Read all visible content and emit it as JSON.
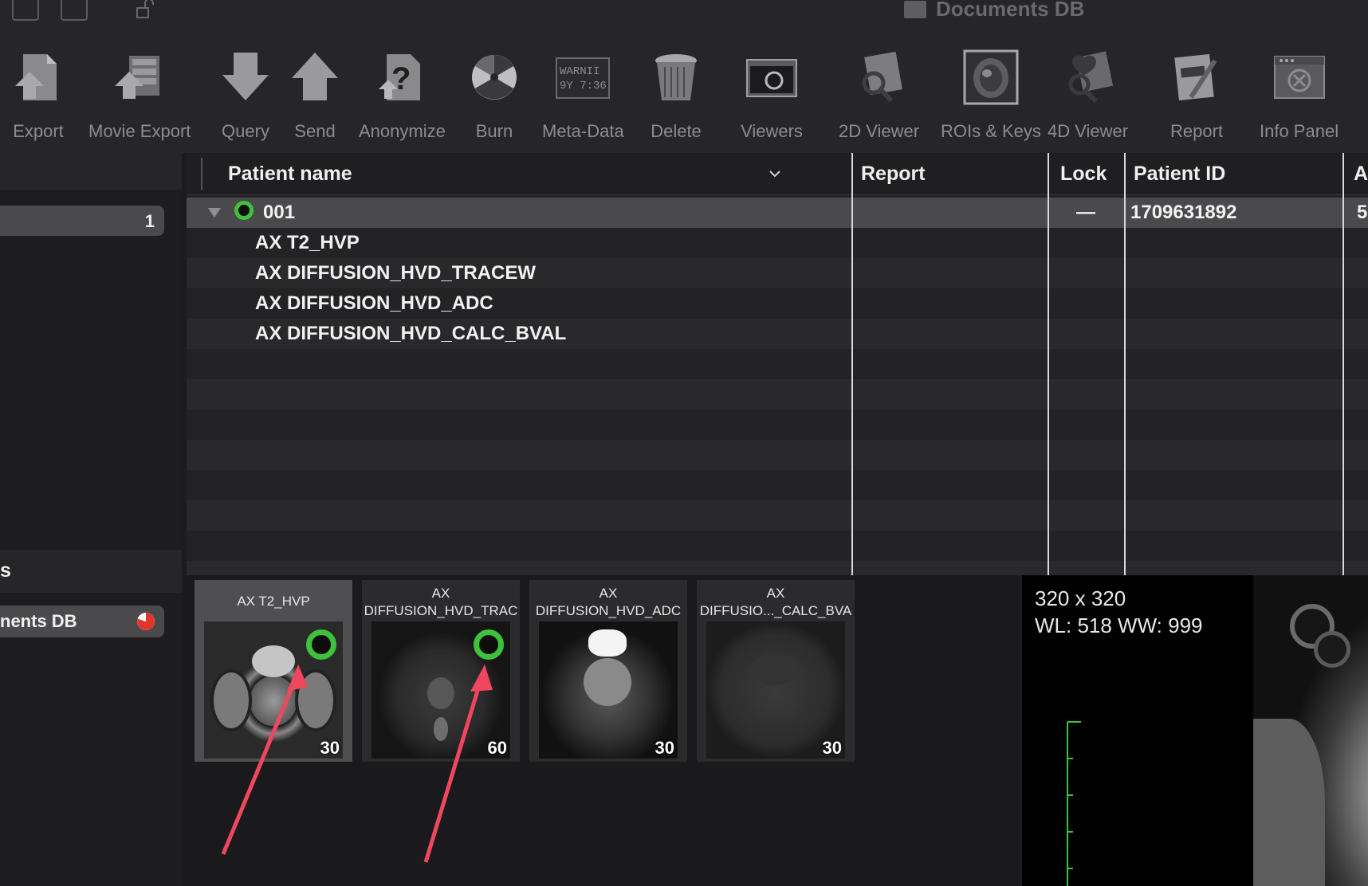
{
  "window": {
    "title": "Documents DB"
  },
  "toolbar": [
    {
      "id": "export",
      "label": "Export",
      "icon": "export-icon"
    },
    {
      "id": "movie-export",
      "label": "Movie Export",
      "icon": "movie-export-icon"
    },
    {
      "id": "query",
      "label": "Query",
      "icon": "query-icon"
    },
    {
      "id": "send",
      "label": "Send",
      "icon": "send-icon"
    },
    {
      "id": "anonymize",
      "label": "Anonymize",
      "icon": "anonymize-icon"
    },
    {
      "id": "burn",
      "label": "Burn",
      "icon": "burn-icon"
    },
    {
      "id": "meta-data",
      "label": "Meta-Data",
      "icon": "meta-data-icon",
      "icon_text": [
        "WARNII",
        "9Y 7:36"
      ]
    },
    {
      "id": "delete",
      "label": "Delete",
      "icon": "trash-icon"
    },
    {
      "id": "viewers",
      "label": "Viewers",
      "icon": "viewers-icon"
    },
    {
      "id": "2d-viewer",
      "label": "2D Viewer",
      "icon": "2d-viewer-icon"
    },
    {
      "id": "rois-keys",
      "label": "ROIs & Keys",
      "icon": "rois-keys-icon"
    },
    {
      "id": "4d-viewer",
      "label": "4D Viewer",
      "icon": "4d-viewer-icon"
    },
    {
      "id": "report",
      "label": "Report",
      "icon": "report-icon"
    },
    {
      "id": "info-panel",
      "label": "Info Panel",
      "icon": "info-panel-icon"
    }
  ],
  "sidebar": {
    "album_count": "1",
    "sources_header": "s",
    "source_label": "nents DB",
    "source_status_color": "#e5332a"
  },
  "table": {
    "columns": {
      "patient_name": "Patient name",
      "report": "Report",
      "lock": "Lock",
      "patient_id": "Patient ID",
      "next": "A"
    },
    "patient": {
      "name": "001",
      "lock": "—",
      "patient_id": "1709631892",
      "next": "5",
      "status_color": "#3ec23c"
    },
    "series": [
      "AX T2_HVP",
      "AX DIFFUSION_HVD_TRACEW",
      "AX DIFFUSION_HVD_ADC",
      "AX DIFFUSION_HVD_CALC_BVAL"
    ]
  },
  "thumbnails": [
    {
      "title": "AX T2_HVP",
      "count": "30",
      "selected": true,
      "marked": true
    },
    {
      "title": "AX\nDIFFUSION_HVD_TRAC",
      "count": "60",
      "selected": false,
      "marked": true
    },
    {
      "title": "AX\nDIFFUSION_HVD_ADC",
      "count": "30",
      "selected": false,
      "marked": false
    },
    {
      "title": "AX\nDIFFUSIO..._CALC_BVA",
      "count": "30",
      "selected": false,
      "marked": false
    }
  ],
  "preview": {
    "matrix": "320 x 320",
    "window": "WL: 518 WW: 999",
    "scale_color": "#3ec23c"
  },
  "annotation_color": "#f0465e"
}
